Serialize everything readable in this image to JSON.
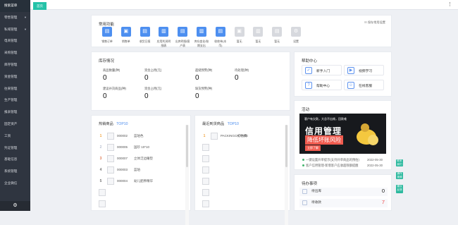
{
  "sidebar": {
    "items": [
      {
        "label": "搜索菜单",
        "caret": ""
      },
      {
        "label": "零售管理",
        "caret": "▼"
      },
      {
        "label": "私域管理",
        "caret": "▼"
      },
      {
        "label": "电商管理",
        "caret": ""
      },
      {
        "label": "采购管理",
        "caret": ""
      },
      {
        "label": "库存管理",
        "caret": ""
      },
      {
        "label": "资金管理",
        "caret": ""
      },
      {
        "label": "往来管理",
        "caret": ""
      },
      {
        "label": "生产管理",
        "caret": ""
      },
      {
        "label": "报表管理",
        "caret": ""
      },
      {
        "label": "固定资产",
        "caret": ""
      },
      {
        "label": "工资",
        "caret": ""
      },
      {
        "label": "凭证管理",
        "caret": ""
      },
      {
        "label": "基础信息",
        "caret": ""
      },
      {
        "label": "系统管理",
        "caret": ""
      },
      {
        "label": "企业微信",
        "caret": ""
      }
    ],
    "gear": "⚙"
  },
  "topbar": {
    "home": "首页",
    "menu": "⋮"
  },
  "common": {
    "title": "常用功能",
    "settings": "☷ 保存常用设置",
    "items": [
      {
        "label": "销售订单",
        "icon": "▤",
        "state": "blue"
      },
      {
        "label": "销售单",
        "icon": "▣",
        "state": "blue"
      },
      {
        "label": "收货日报",
        "icon": "▤",
        "state": "blue"
      },
      {
        "label": "应用利润明细表",
        "icon": "▥",
        "state": "blue"
      },
      {
        "label": "出库明细/客户表",
        "icon": "▤",
        "state": "blue"
      },
      {
        "label": "库存变化/账期支出",
        "icon": "▥",
        "state": "blue"
      },
      {
        "label": "收款单(本币)",
        "icon": "▤",
        "state": "blue"
      },
      {
        "label": "暂无",
        "icon": "▣",
        "state": "gray"
      },
      {
        "label": "暂无",
        "icon": "▥",
        "state": "gray"
      },
      {
        "label": "暂无",
        "icon": "▤",
        "state": "gray"
      },
      {
        "label": "设置",
        "icon": "⚙",
        "state": "gray"
      }
    ]
  },
  "inventory": {
    "title": "库存情况",
    "metrics": [
      {
        "label": "商品数量(种)",
        "value": "0"
      },
      {
        "label": "资金占用(元)",
        "value": "0"
      },
      {
        "label": "超储预警(种)",
        "value": "0"
      },
      {
        "label": "待处理(种)",
        "value": "0"
      },
      {
        "label": "建议补货商品(种)",
        "value": "0"
      },
      {
        "label": "资金占用(元)",
        "value": "0"
      },
      {
        "label": "缺货预警(种)",
        "value": "0"
      }
    ]
  },
  "help": {
    "title": "帮助中心",
    "items": [
      {
        "label": "新手入门",
        "icon": "✓"
      },
      {
        "label": "视频学习",
        "icon": "▶"
      },
      {
        "label": "帮助中心",
        "icon": "?"
      },
      {
        "label": "在线客服",
        "icon": "☺"
      }
    ]
  },
  "activity": {
    "title": "活动",
    "banner": {
      "top": "客户有欠款，大总不出席，回款难",
      "headline1": "信用管理",
      "headline2": "降低坏账风险",
      "button": "立即了解"
    },
    "news": [
      {
        "text": "一键设置开单提示(支持开单商品的预估)",
        "date": "2022-05-30"
      },
      {
        "text": "客户信用管理-新增客户应收超限额提醒",
        "date": "2022-05-30"
      }
    ]
  },
  "hot_products": {
    "title": "热销商品",
    "badge": "TOP10",
    "rows": [
      {
        "rank": "1",
        "code": "000002",
        "name": "蓝珀色"
      },
      {
        "rank": "2",
        "code": "000005",
        "name": "国珍 10*10"
      },
      {
        "rank": "3",
        "code": "000007",
        "name": "立体泛边睡垫"
      },
      {
        "rank": "4",
        "code": "000003",
        "name": "蓝珀"
      },
      {
        "rank": "5",
        "code": "000004",
        "name": "幼儿配养精华"
      }
    ]
  },
  "recent_products": {
    "title": "最近到货商品",
    "badge": "TOP10",
    "rows": [
      {
        "rank": "1",
        "code": "PACKINGCHARGE",
        "name": "打包费"
      }
    ]
  },
  "todo": {
    "title": "待办事项",
    "rows": [
      {
        "label": "待出库",
        "count": "0"
      },
      {
        "label": "待收款",
        "count": "7"
      }
    ]
  },
  "side_chips": [
    "联系我们",
    "操作视频",
    "建议反馈"
  ],
  "colors": {
    "sidebar": "#2f3540",
    "accent": "#25c2a8",
    "blue": "#4d8ff0",
    "danger": "#ef4c4c",
    "gold": "#f2a33a"
  }
}
